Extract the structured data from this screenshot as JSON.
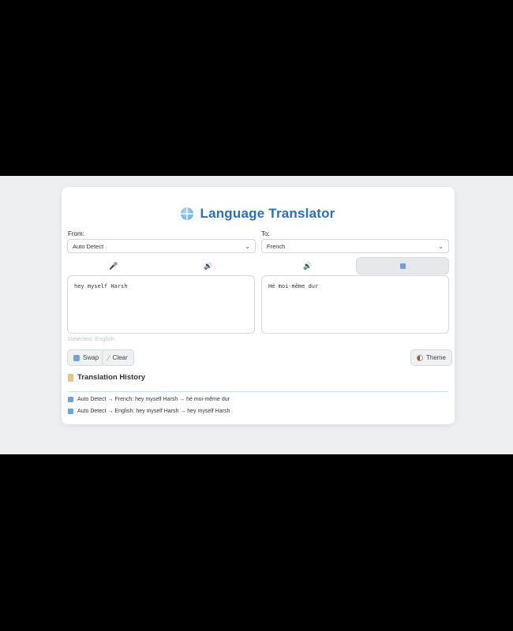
{
  "app": {
    "title": "Language Translator"
  },
  "from": {
    "label": "From:",
    "selected": "Auto Detect"
  },
  "to": {
    "label": "To:",
    "selected": "French"
  },
  "toolbar": {
    "source_tools": [
      "mic-icon",
      "speaker-icon"
    ],
    "target_tools": [
      "speaker-icon",
      "copy-icon"
    ]
  },
  "source_text": "hey myself Harsh",
  "target_text": "Hé moi-même dur",
  "detected": "Detected: English",
  "buttons": {
    "swap": "Swap",
    "clear": "Clear",
    "theme": "Theme"
  },
  "history": {
    "title": "Translation History",
    "items": [
      "Auto Detect → French: hey myself Harsh → hé moi-même dur",
      "Auto Detect → English: hey myself Harsh → hey myself Harsh"
    ]
  },
  "colors": {
    "accent": "#2d6fb8",
    "background": "#eeeff0",
    "card": "#ffffff"
  }
}
